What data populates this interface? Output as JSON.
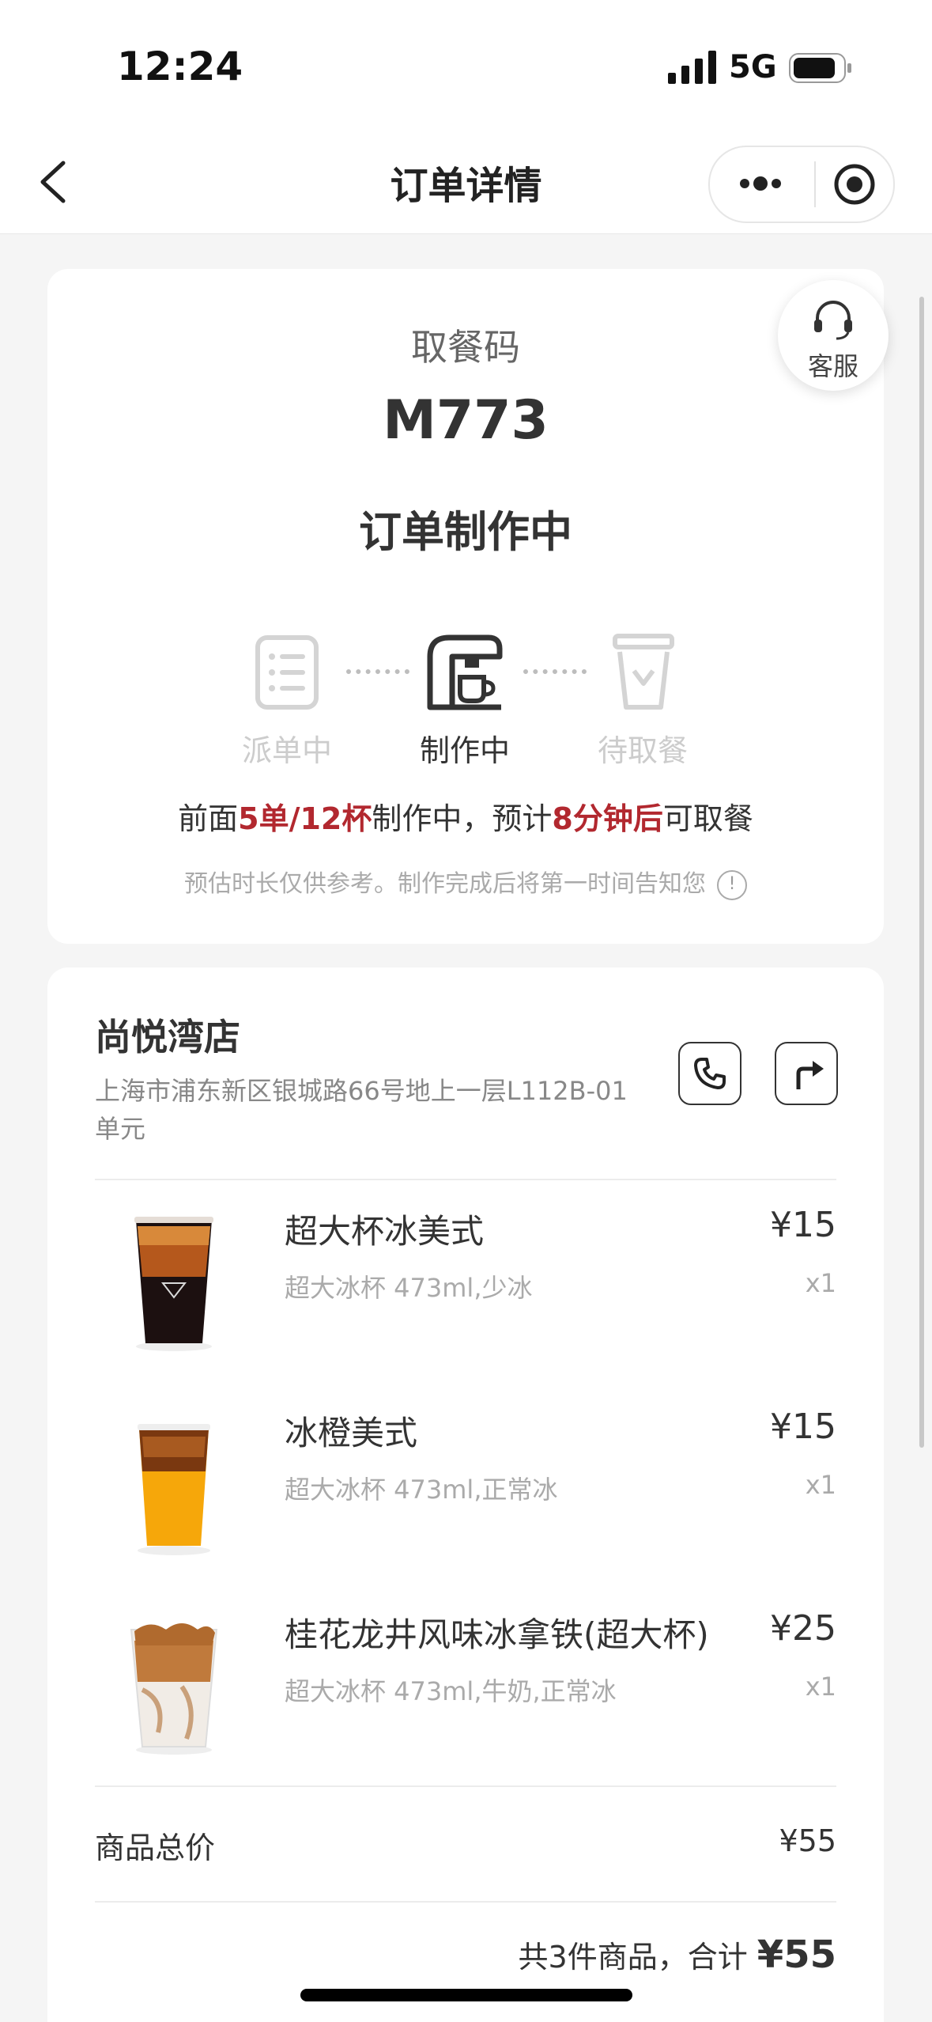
{
  "status_bar": {
    "time": "12:24",
    "network": "5G"
  },
  "nav": {
    "title": "订单详情"
  },
  "customer_service": {
    "label": "客服"
  },
  "pickup": {
    "label": "取餐码",
    "code": "M773"
  },
  "order_status": "订单制作中",
  "steps": [
    {
      "label": "派单中",
      "state": "done"
    },
    {
      "label": "制作中",
      "state": "active"
    },
    {
      "label": "待取餐",
      "state": "pending"
    }
  ],
  "eta": {
    "prefix": "前面",
    "queue": "5单/12杯",
    "middle": "制作中，预计",
    "time": "8分钟后",
    "suffix": "可取餐"
  },
  "note": "预估时长仅供参考。制作完成后将第一时间告知您",
  "store": {
    "name": "尚悦湾店",
    "address": "上海市浦东新区银城路66号地上一层L112B-01单元"
  },
  "items": [
    {
      "name": "超大杯冰美式",
      "spec": "超大冰杯 473ml,少冰",
      "price": "¥15",
      "qty": "x1"
    },
    {
      "name": "冰橙美式",
      "spec": "超大冰杯 473ml,正常冰",
      "price": "¥15",
      "qty": "x1"
    },
    {
      "name": "桂花龙井风味冰拿铁(超大杯)",
      "spec": "超大冰杯 473ml,牛奶,正常冰",
      "price": "¥25",
      "qty": "x1"
    }
  ],
  "summary": {
    "goods_total_label": "商品总价",
    "goods_total_value": "¥55",
    "count_text": "共3件商品，合计",
    "grand_total": "¥55"
  },
  "colors": {
    "highlight": "#b2282f",
    "background": "#f5f5f5"
  }
}
